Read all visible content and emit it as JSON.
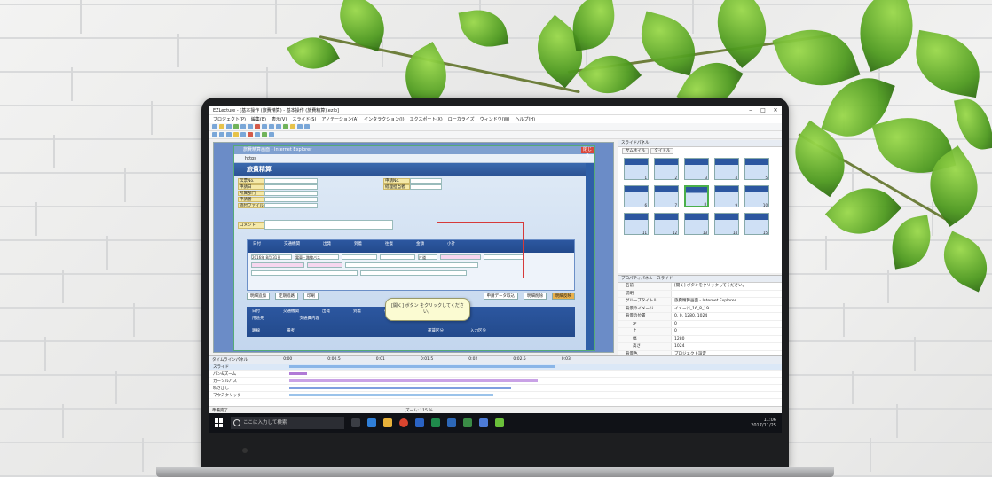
{
  "app": {
    "title": "EZLecture - [基本操作 (旅費精算) - 基本操作 (旅費精算).ezlp]",
    "menu": [
      "プロジェクト(P)",
      "編集(E)",
      "表示(V)",
      "スライド(S)",
      "アノテーション(A)",
      "インタラクション(I)",
      "エクスポート(X)",
      "ローカライズ",
      "ウィンドウ(W)",
      "ヘルプ(H)"
    ],
    "window_controls": [
      "‒",
      "□",
      "✕"
    ]
  },
  "ie": {
    "title": "旅費精算画面 - Internet Explorer",
    "close": "閉じる",
    "address": "https",
    "page_title": "旅費精算"
  },
  "form": {
    "labels": [
      "伝票No.",
      "申請日",
      "所属部門",
      "申請者",
      "添付ファイル"
    ],
    "right_labels": [
      "申請No.",
      "経理担当者"
    ],
    "comment_label": "コメント"
  },
  "table": {
    "headers": [
      "日付",
      "交通機関",
      "出発",
      "到着",
      "往復",
      "金額",
      "小計"
    ],
    "subheaders": [
      "用途先",
      "交通費内容",
      "備考"
    ],
    "row_date": "2016年 8月 31日",
    "row_transport": "電車・路線バス",
    "row_trip": "片道"
  },
  "buttons": [
    "明細追加",
    "定期経路",
    "印刷",
    "申請データ取込",
    "明細削除",
    "明細反映"
  ],
  "table2": {
    "headers": [
      "日付",
      "交通機関",
      "出発",
      "到着",
      "往復",
      "金額",
      "小計"
    ],
    "sub": [
      "用途先",
      "交通費内容"
    ],
    "footer": [
      "路線",
      "備考",
      "運賃区分",
      "入力区分"
    ]
  },
  "tooltip": "[開く] ボタン をクリックしてください。",
  "slide_panel": {
    "title": "スライドパネル",
    "tabs": [
      "サムネイル",
      "タイトル"
    ],
    "thumbs": [
      "1",
      "2",
      "3",
      "4",
      "5",
      "6",
      "7",
      "8",
      "9",
      "10",
      "11",
      "12",
      "13",
      "14",
      "15"
    ],
    "selected": "8"
  },
  "prop_panel": {
    "title": "プロパティパネル - スライド",
    "rows": [
      {
        "name": "名前",
        "value": "[開く] ボタンをクリックしてください。"
      },
      {
        "name": "説明",
        "value": ""
      },
      {
        "name": "グループタイトル",
        "value": "旅費精算画面 - Internet Explorer"
      },
      {
        "name": "背景のイメージ",
        "value": "イメージ_16_8_19"
      },
      {
        "name": "背景の位置",
        "value": "0, 0, 1280, 1024"
      },
      {
        "name": "左",
        "value": "0"
      },
      {
        "name": "上",
        "value": "0"
      },
      {
        "name": "幅",
        "value": "1280"
      },
      {
        "name": "高さ",
        "value": "1024"
      },
      {
        "name": "背景色",
        "value": "プロジェクト設定"
      },
      {
        "name": "指定時間",
        "value": "2000 ミリ秒"
      },
      {
        "name": "トランジション効果",
        "value": "なし"
      }
    ]
  },
  "timeline": {
    "title": "タイムラインパネル",
    "ticks": [
      "0:00",
      "0:00.5",
      "0:01",
      "0:01.5",
      "0:02",
      "0:02.5",
      "0:03"
    ],
    "tracks": [
      "スライド",
      "パン&ズーム",
      "カーソルパス",
      "吹き出し",
      "マウスクリック"
    ]
  },
  "status": {
    "left": "準備完了",
    "zoom": "ズーム: 115 %"
  },
  "taskbar": {
    "search_placeholder": "ここに入力して検索",
    "time": "11:06",
    "date": "2017/11/25"
  }
}
